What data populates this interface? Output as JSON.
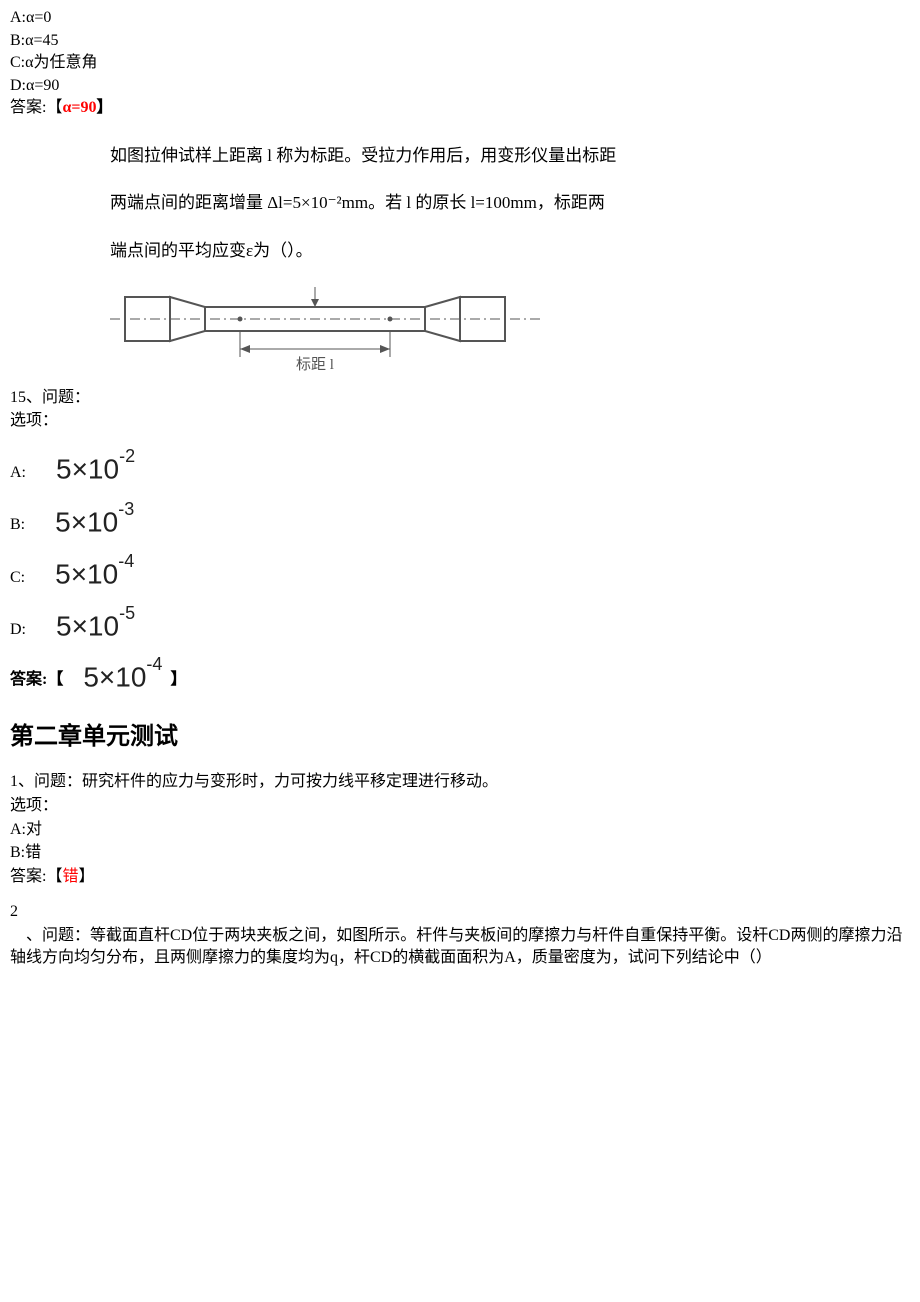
{
  "q14": {
    "optA": "A:α=0",
    "optB": "B:α=45",
    "optC": "C:α为任意角",
    "optD": "D:α=90",
    "ansLabel": "答案:【",
    "ansValue": "α=90",
    "ansClose": "】"
  },
  "q15": {
    "textLine1": "如图拉伸试样上距离 l 称为标距。受拉力作用后，用变形仪量出标距",
    "textLine2": "两端点间的距离增量 Δl=5×10⁻²mm。若 l 的原长 l=100mm，标距两",
    "textLine3": "端点间的平均应变ε为（）。",
    "specimenLabel": "标距 l",
    "number": "15、问题：",
    "optionsLabel": "选项：",
    "optA_label": "A:",
    "optA_expr_base": "5×10",
    "optA_expr_sup": "-2",
    "optB_label": "B:",
    "optB_expr_base": "5×10",
    "optB_expr_sup": "-3",
    "optC_label": "C:",
    "optC_expr_base": "5×10",
    "optC_expr_sup": "-4",
    "optD_label": "D:",
    "optD_expr_base": "5×10",
    "optD_expr_sup": "-5",
    "ansLabel": "答案:【",
    "ans_expr_base": "5×10",
    "ans_expr_sup": "-4",
    "ansClose": "】"
  },
  "chapter2": {
    "title": "第二章单元测试"
  },
  "c2q1": {
    "line1": "1、问题：研究杆件的应力与变形时，力可按力线平移定理进行移动。",
    "optionsLabel": "选项：",
    "optA": "A:对",
    "optB": "B:错",
    "ansLabel": "答案:【",
    "ansValue": "错",
    "ansClose": "】"
  },
  "c2q2": {
    "num": "2",
    "text": "、问题：等截面直杆CD位于两块夹板之间，如图所示。杆件与夹板间的摩擦力与杆件自重保持平衡。设杆CD两侧的摩擦力沿轴线方向均匀分布，且两侧摩擦力的集度均为q，杆CD的横截面面积为A，质量密度为，试问下列结论中（）"
  }
}
